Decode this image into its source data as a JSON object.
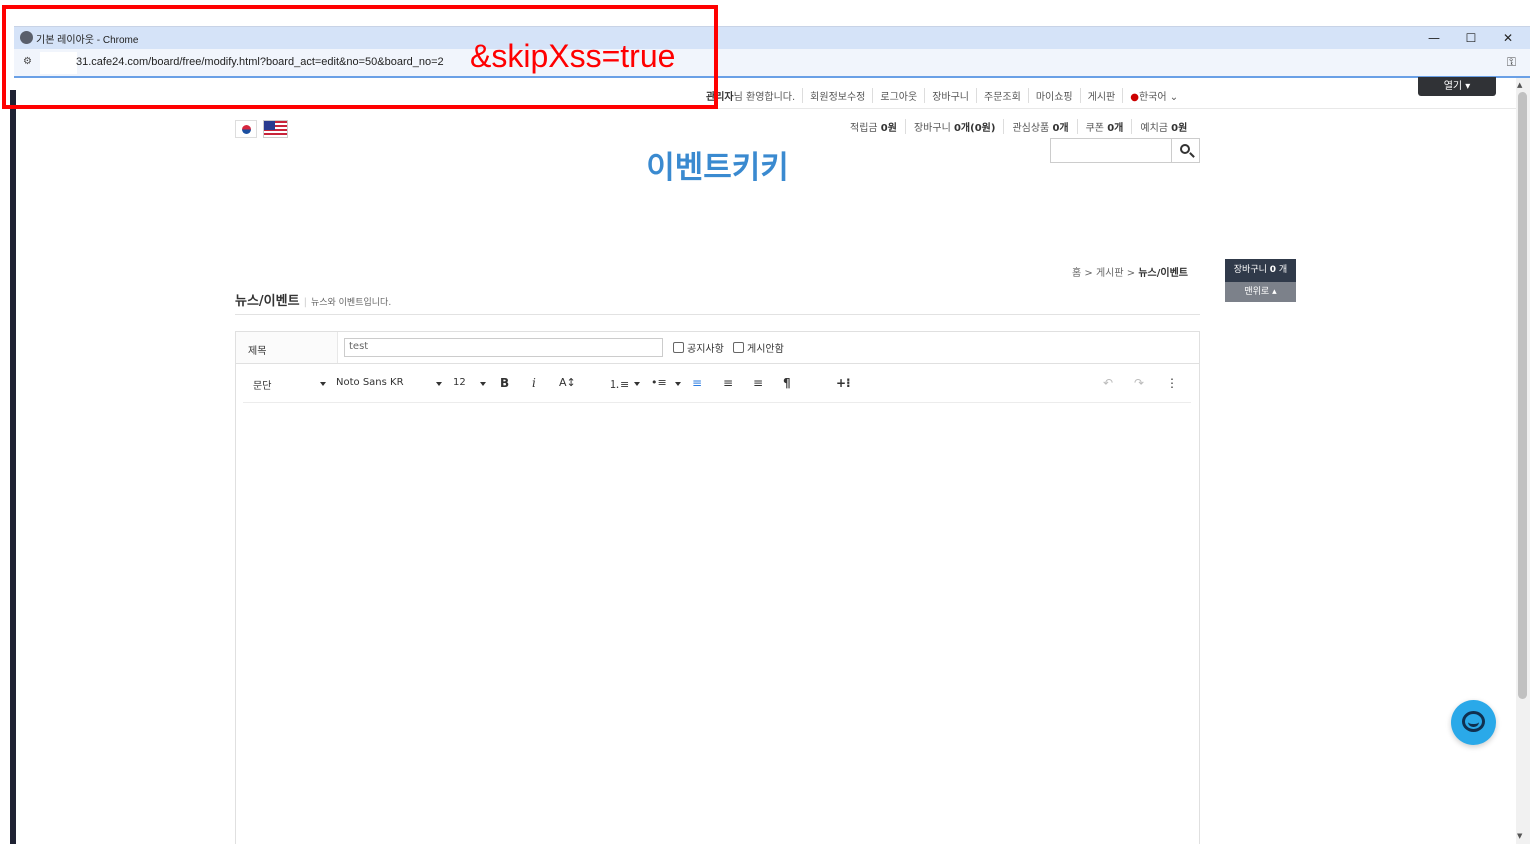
{
  "browser": {
    "window_title": "기본 레이아웃 - Chrome",
    "url_visible": "31.cafe24.com/board/free/modify.html?board_act=edit&no=50&board_no=2",
    "open_button": "열기 ▾",
    "minimize": "—",
    "maximize": "☐",
    "close": "✕"
  },
  "annotation": {
    "text": "&skipXss=true",
    "color": "#ff0000"
  },
  "top_menu": {
    "welcome_bold": "관리자",
    "welcome_rest": "님 환영합니다.",
    "items": [
      "회원정보수정",
      "로그아웃",
      "장바구니",
      "주문조회",
      "마이쇼핑",
      "게시판"
    ],
    "language": "한국어"
  },
  "info_line": {
    "items": [
      {
        "label": "적립금",
        "value": "0원"
      },
      {
        "label": "장바구니",
        "value": "0개(0원)"
      },
      {
        "label": "관심상품",
        "value": "0개"
      },
      {
        "label": "쿠폰",
        "value": "0개"
      },
      {
        "label": "예치금",
        "value": "0원"
      }
    ]
  },
  "logo": "이벤트키키",
  "breadcrumb": {
    "home": "홈",
    "board": "게시판",
    "current": "뉴스/이벤트",
    "sep": ">"
  },
  "quick": {
    "cart_label": "장바구니",
    "cart_count": "0",
    "cart_unit": "개",
    "top_label": "맨위로"
  },
  "board": {
    "title": "뉴스/이벤트",
    "description": "뉴스와 이벤트입니다."
  },
  "form": {
    "subject_label": "제목",
    "subject_value": "test",
    "notice_label": "공지사항",
    "hide_label": "게시안함"
  },
  "editor": {
    "paragraph": "문단",
    "font": "Noto Sans KR",
    "size": "12",
    "bold": "B",
    "italic": "i",
    "fontsize_icon": "A↕",
    "ol_icon": "⒈≡",
    "ul_icon": "•≡",
    "align_left": "≡",
    "align_center": "≡",
    "align_right": "≡",
    "paragraph_mark": "¶",
    "insert": "+⁝",
    "undo": "↶",
    "redo": "↷",
    "more": "⋮"
  },
  "colors": {
    "accent": "#3a8ad0",
    "annotation": "#ff0000",
    "dark_button": "#303236",
    "chat": "#2aa9e9"
  }
}
